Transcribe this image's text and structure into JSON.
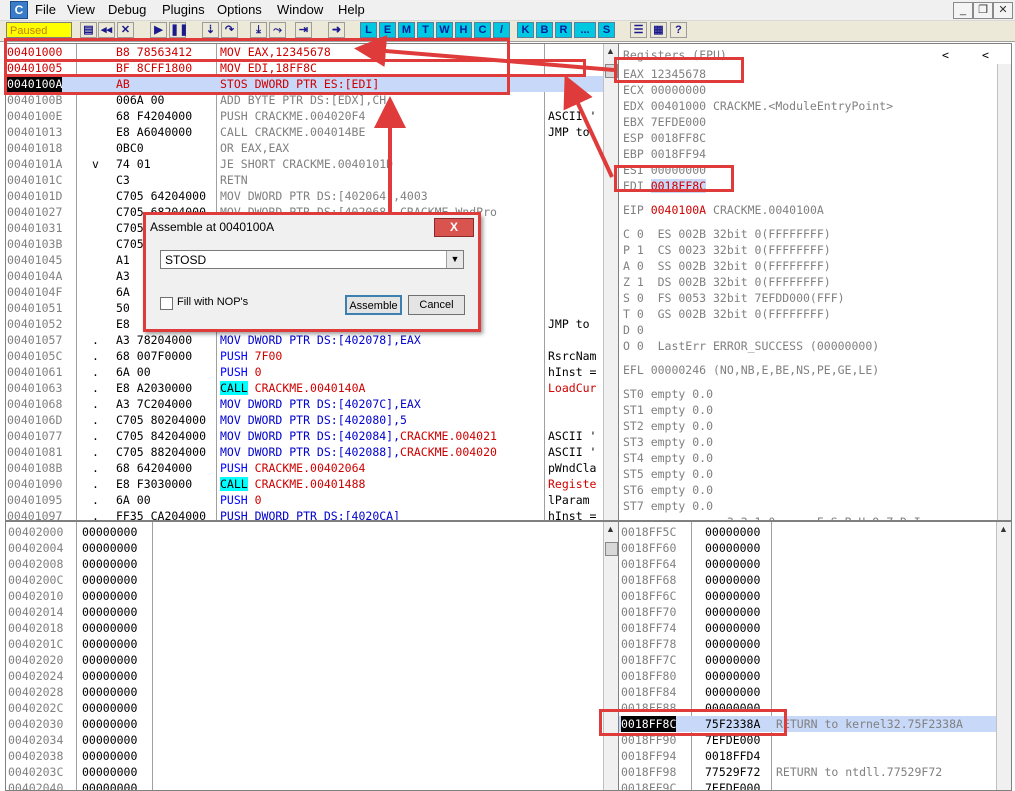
{
  "menu": [
    "File",
    "View",
    "Debug",
    "Plugins",
    "Options",
    "Window",
    "Help"
  ],
  "app_icon": "C",
  "status": "Paused",
  "toolbar": {
    "icons": [
      "open-icon",
      "rewind-icon",
      "close-icon",
      "run-icon",
      "pause-icon",
      "step-into-icon",
      "step-over-icon",
      "trace-into-icon",
      "trace-over-icon",
      "execute-till-return-icon",
      "goto-icon"
    ],
    "letters": [
      "L",
      "E",
      "M",
      "T",
      "W",
      "H",
      "C",
      "/",
      "K",
      "B",
      "R",
      "...",
      "S"
    ],
    "extra_icons": [
      "list-icon",
      "grid-icon",
      "help-icon"
    ]
  },
  "disasm": [
    {
      "addr": "00401000",
      "mark": "",
      "hex": "B8 78563412",
      "asm": "MOV EAX,12345678",
      "cmt": "",
      "style": "red"
    },
    {
      "addr": "00401005",
      "mark": "",
      "hex": "BF 8CFF1800",
      "asm": "MOV EDI,18FF8C",
      "cmt": "",
      "style": "red"
    },
    {
      "addr": "0040100A",
      "mark": "",
      "hex": "AB",
      "asm": "STOS DWORD PTR ES:[EDI]",
      "cmt": "",
      "style": "sel"
    },
    {
      "addr": "0040100B",
      "mark": "",
      "hex": "006A 00",
      "asm": "ADD BYTE PTR DS:[EDX],CH",
      "cmt": "",
      "style": ""
    },
    {
      "addr": "0040100E",
      "mark": "",
      "hex": "68 F4204000",
      "asm": "PUSH CRACKME.004020F4",
      "cmt": "ASCII '",
      "style": ""
    },
    {
      "addr": "00401013",
      "mark": "",
      "hex": "E8 A6040000",
      "asm": "CALL CRACKME.004014BE",
      "cmt": "JMP to",
      "style": ""
    },
    {
      "addr": "00401018",
      "mark": "",
      "hex": "0BC0",
      "asm": "OR EAX,EAX",
      "cmt": "",
      "style": ""
    },
    {
      "addr": "0040101A",
      "mark": "v",
      "hex": "74 01",
      "asm": "JE SHORT CRACKME.0040101D",
      "cmt": "",
      "style": ""
    },
    {
      "addr": "0040101C",
      "mark": "",
      "hex": "C3",
      "asm": "RETN",
      "cmt": "",
      "style": ""
    },
    {
      "addr": "0040101D",
      "mark": "",
      "hex": "C705 64204000",
      "asm": "MOV DWORD PTR DS:[402064],4003",
      "cmt": "",
      "style": ""
    },
    {
      "addr": "00401027",
      "mark": "",
      "hex": "C705 68204000",
      "asm": "MOV DWORD PTR DS:[402068],CRACKME.WndPro",
      "cmt": "",
      "style": ""
    },
    {
      "addr": "00401031",
      "mark": "",
      "hex": "C705",
      "asm": "",
      "cmt": "",
      "style": ""
    },
    {
      "addr": "0040103B",
      "mark": "",
      "hex": "C705",
      "asm": "",
      "cmt": "",
      "style": ""
    },
    {
      "addr": "00401045",
      "mark": "",
      "hex": "A1",
      "asm": "",
      "cmt": "",
      "style": ""
    },
    {
      "addr": "0040104A",
      "mark": "",
      "hex": "A3",
      "asm": "",
      "cmt": "",
      "style": ""
    },
    {
      "addr": "0040104F",
      "mark": "",
      "hex": "6A",
      "asm": "",
      "cmt": "",
      "style": ""
    },
    {
      "addr": "00401051",
      "mark": "",
      "hex": "50",
      "asm": "",
      "cmt": "",
      "style": ""
    },
    {
      "addr": "00401052",
      "mark": "",
      "hex": "E8",
      "asm": "",
      "cmt": "JMP to",
      "style": ""
    },
    {
      "addr": "00401057",
      "mark": ".",
      "hex": "A3 78204000",
      "asm": "MOV DWORD PTR DS:[402078],EAX",
      "cmt": "",
      "style": ""
    },
    {
      "addr": "0040105C",
      "mark": ".",
      "hex": "68 007F0000",
      "asm": "PUSH 7F00",
      "cmt": "RsrcNam",
      "style": "push"
    },
    {
      "addr": "00401061",
      "mark": ".",
      "hex": "6A 00",
      "asm": "PUSH 0",
      "cmt": "hInst =",
      "style": "push"
    },
    {
      "addr": "00401063",
      "mark": ".",
      "hex": "E8 A2030000",
      "asm": "CALL CRACKME.0040140A",
      "cmt": "LoadCur",
      "style": "call"
    },
    {
      "addr": "00401068",
      "mark": ".",
      "hex": "A3 7C204000",
      "asm": "MOV DWORD PTR DS:[40207C],EAX",
      "cmt": "",
      "style": ""
    },
    {
      "addr": "0040106D",
      "mark": ".",
      "hex": "C705 80204000",
      "asm": "MOV DWORD PTR DS:[402080],5",
      "cmt": "",
      "style": ""
    },
    {
      "addr": "00401077",
      "mark": ".",
      "hex": "C705 84204000",
      "asm": "MOV DWORD PTR DS:[402084],CRACKME.004021",
      "cmt": "ASCII '",
      "style": "movred"
    },
    {
      "addr": "00401081",
      "mark": ".",
      "hex": "C705 88204000",
      "asm": "MOV DWORD PTR DS:[402088],CRACKME.004020",
      "cmt": "ASCII '",
      "style": "movred"
    },
    {
      "addr": "0040108B",
      "mark": ".",
      "hex": "68 64204000",
      "asm": "PUSH CRACKME.00402064",
      "cmt": "pWndCla",
      "style": "push"
    },
    {
      "addr": "00401090",
      "mark": ".",
      "hex": "E8 F3030000",
      "asm": "CALL CRACKME.00401488",
      "cmt": "Registe",
      "style": "call"
    },
    {
      "addr": "00401095",
      "mark": ".",
      "hex": "6A 00",
      "asm": "PUSH 0",
      "cmt": "lParam",
      "style": "push"
    },
    {
      "addr": "00401097",
      "mark": ".",
      "hex": "FF35 CA204000",
      "asm": "PUSH DWORD PTR DS:[4020CA]",
      "cmt": "hInst =",
      "style": ""
    }
  ],
  "registers": {
    "title": "Registers (FPU)",
    "lines": [
      {
        "t": "EAX 12345678",
        "c": "normal"
      },
      {
        "t": "ECX 00000000",
        "c": "normal"
      },
      {
        "t": "EDX 00401000 CRACKME.<ModuleEntryPoint>",
        "c": "normal"
      },
      {
        "t": "EBX 7EFDE000",
        "c": "normal"
      },
      {
        "t": "ESP 0018FF8C",
        "c": "normal"
      },
      {
        "t": "EBP 0018FF94",
        "c": "normal"
      },
      {
        "t": "ESI 00000000",
        "c": "normal"
      },
      {
        "t": "EDI 0018FF8C",
        "c": "edi"
      },
      {
        "t": "",
        "c": "normal"
      },
      {
        "t": "EIP 0040100A CRACKME.0040100A",
        "c": "eip"
      },
      {
        "t": "",
        "c": "normal"
      },
      {
        "t": "C 0  ES 002B 32bit 0(FFFFFFFF)",
        "c": "normal"
      },
      {
        "t": "P 1  CS 0023 32bit 0(FFFFFFFF)",
        "c": "normal"
      },
      {
        "t": "A 0  SS 002B 32bit 0(FFFFFFFF)",
        "c": "normal"
      },
      {
        "t": "Z 1  DS 002B 32bit 0(FFFFFFFF)",
        "c": "normal"
      },
      {
        "t": "S 0  FS 0053 32bit 7EFDD000(FFF)",
        "c": "normal"
      },
      {
        "t": "T 0  GS 002B 32bit 0(FFFFFFFF)",
        "c": "normal"
      },
      {
        "t": "D 0",
        "c": "normal"
      },
      {
        "t": "O 0  LastErr ERROR_SUCCESS (00000000)",
        "c": "normal"
      },
      {
        "t": "",
        "c": "normal"
      },
      {
        "t": "EFL 00000246 (NO,NB,E,BE,NS,PE,GE,LE)",
        "c": "normal"
      },
      {
        "t": "",
        "c": "normal"
      },
      {
        "t": "ST0 empty 0.0",
        "c": "normal"
      },
      {
        "t": "ST1 empty 0.0",
        "c": "normal"
      },
      {
        "t": "ST2 empty 0.0",
        "c": "normal"
      },
      {
        "t": "ST3 empty 0.0",
        "c": "normal"
      },
      {
        "t": "ST4 empty 0.0",
        "c": "normal"
      },
      {
        "t": "ST5 empty 0.0",
        "c": "normal"
      },
      {
        "t": "ST6 empty 0.0",
        "c": "normal"
      },
      {
        "t": "ST7 empty 0.0",
        "c": "normal"
      },
      {
        "t": "               3 2 1 0      E S P U O Z D I",
        "c": "normal"
      }
    ]
  },
  "dump": {
    "addrs": [
      "00402000",
      "00402004",
      "00402008",
      "0040200C",
      "00402010",
      "00402014",
      "00402018",
      "0040201C",
      "00402020",
      "00402024",
      "00402028",
      "0040202C",
      "00402030",
      "00402034",
      "00402038",
      "0040203C",
      "00402040"
    ],
    "vals": [
      "00000000",
      "00000000",
      "00000000",
      "00000000",
      "00000000",
      "00000000",
      "00000000",
      "00000000",
      "00000000",
      "00000000",
      "00000000",
      "00000000",
      "00000000",
      "00000000",
      "00000000",
      "00000000",
      "00000000"
    ]
  },
  "stack": [
    {
      "addr": "0018FF5C",
      "val": "00000000",
      "cmt": ""
    },
    {
      "addr": "0018FF60",
      "val": "00000000",
      "cmt": ""
    },
    {
      "addr": "0018FF64",
      "val": "00000000",
      "cmt": ""
    },
    {
      "addr": "0018FF68",
      "val": "00000000",
      "cmt": ""
    },
    {
      "addr": "0018FF6C",
      "val": "00000000",
      "cmt": ""
    },
    {
      "addr": "0018FF70",
      "val": "00000000",
      "cmt": ""
    },
    {
      "addr": "0018FF74",
      "val": "00000000",
      "cmt": ""
    },
    {
      "addr": "0018FF78",
      "val": "00000000",
      "cmt": ""
    },
    {
      "addr": "0018FF7C",
      "val": "00000000",
      "cmt": ""
    },
    {
      "addr": "0018FF80",
      "val": "00000000",
      "cmt": ""
    },
    {
      "addr": "0018FF84",
      "val": "00000000",
      "cmt": ""
    },
    {
      "addr": "0018FF88",
      "val": "00000000",
      "cmt": ""
    },
    {
      "addr": "0018FF8C",
      "val": "75F2338A",
      "cmt": "RETURN to kernel32.75F2338A",
      "sel": true
    },
    {
      "addr": "0018FF90",
      "val": "7EFDE000",
      "cmt": ""
    },
    {
      "addr": "0018FF94",
      "val": "0018FFD4",
      "cmt": ""
    },
    {
      "addr": "0018FF98",
      "val": "77529F72",
      "cmt": "RETURN to ntdll.77529F72"
    },
    {
      "addr": "0018FF9C",
      "val": "7EFDE000",
      "cmt": ""
    }
  ],
  "dialog": {
    "title": "Assemble at 0040100A",
    "input": "STOSD",
    "checkbox": "Fill with NOP's",
    "assemble": "Assemble",
    "cancel": "Cancel",
    "close": "X"
  },
  "colors": {
    "annotation": "#e03b3b",
    "selection": "#c8d8f8",
    "call_bg": "#00ffff",
    "status_bg": "#ffff00"
  }
}
